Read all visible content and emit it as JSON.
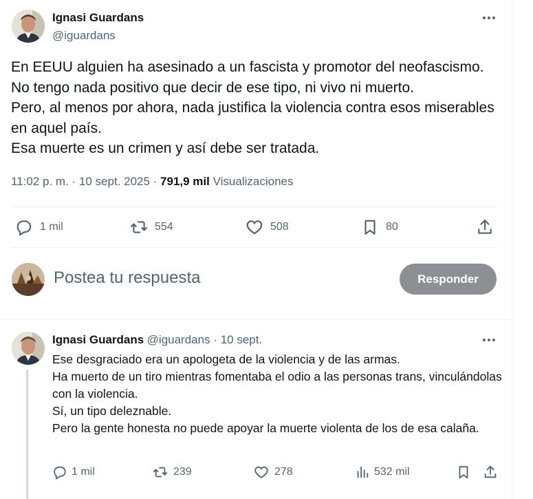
{
  "tweet": {
    "author_name": "Ignasi Guardans",
    "author_handle": "@iguardans",
    "text": "En EEUU alguien ha asesinado a un fascista y promotor del neofascismo.\nNo tengo nada positivo que decir de ese tipo, ni vivo ni muerto.\nPero, al menos por ahora, nada justifica la violencia contra esos miserables en aquel país.\nEsa muerte es un crimen y así debe ser tratada.",
    "time": "11:02 p. m.",
    "separator": " · ",
    "date": "10 sept. 2025",
    "views_count": "791,9 mil",
    "views_label": "Visualizaciones",
    "replies": "1 mil",
    "retweets": "554",
    "likes": "508",
    "bookmarks": "80"
  },
  "composer": {
    "placeholder": "Postea tu respuesta",
    "button_label": "Responder"
  },
  "reply": {
    "author_name": "Ignasi Guardans",
    "author_handle": "@iguardans",
    "dot": " · ",
    "date": "10 sept.",
    "text": "Ese desgraciado era un apologeta de la violencia y de las armas.\nHa muerto de un tiro mientras fomentaba el odio a las personas trans, vinculándolas con la violencia.\nSí, un tipo deleznable.\nPero la gente honesta no puede apoyar la muerte violenta de los de esa calaña.",
    "replies": "1 mil",
    "retweets": "239",
    "likes": "278",
    "views": "532 mil"
  },
  "colors": {
    "text_primary": "#0f1419",
    "text_secondary": "#536471",
    "divider": "#eff3f4",
    "button_disabled": "#8c9095"
  },
  "icons": [
    "more-icon",
    "reply-icon",
    "retweet-icon",
    "like-icon",
    "bookmark-icon",
    "share-icon",
    "views-icon"
  ]
}
